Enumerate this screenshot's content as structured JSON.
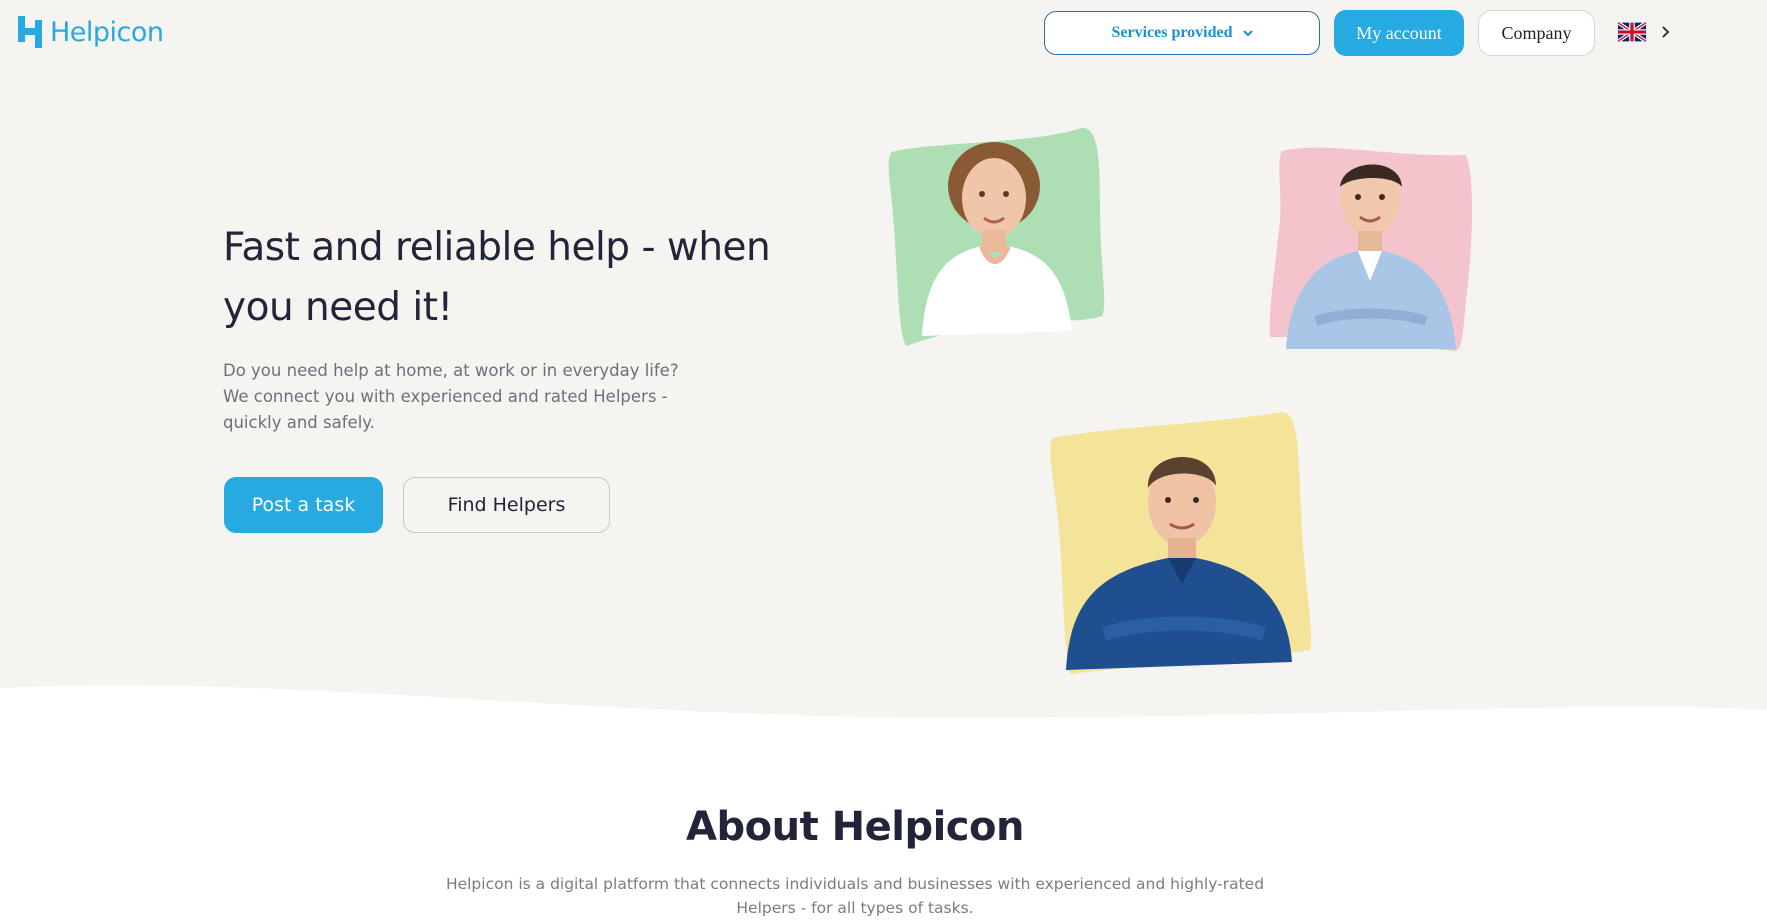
{
  "brand": {
    "name": "Helpicon",
    "color": "#27a9e1"
  },
  "nav": {
    "services_label": "Services provided",
    "account_label": "My account",
    "company_label": "Company",
    "language_icon": "uk-flag-icon"
  },
  "hero": {
    "headline": "Fast and reliable help - when you need it!",
    "subtext": "Do you need help at home, at work or in everyday life? We connect you with experienced and rated Helpers - quickly and safely.",
    "post_task_label": "Post a task",
    "find_helpers_label": "Find Helpers",
    "photos": [
      {
        "name": "helper-photo-woman",
        "bg": "#aedfb4"
      },
      {
        "name": "helper-photo-man-casual",
        "bg": "#f4c4cd"
      },
      {
        "name": "helper-photo-man-shirt",
        "bg": "#f4e49a"
      }
    ]
  },
  "about": {
    "title": "About Helpicon",
    "text": "Helpicon is a digital platform that connects individuals and businesses with experienced and highly-rated Helpers - for all types of tasks."
  },
  "colors": {
    "hero_bg": "#f5f4f1",
    "primary": "#27a9e1",
    "text_dark": "#22253a",
    "text_muted": "#6e6f7b"
  }
}
